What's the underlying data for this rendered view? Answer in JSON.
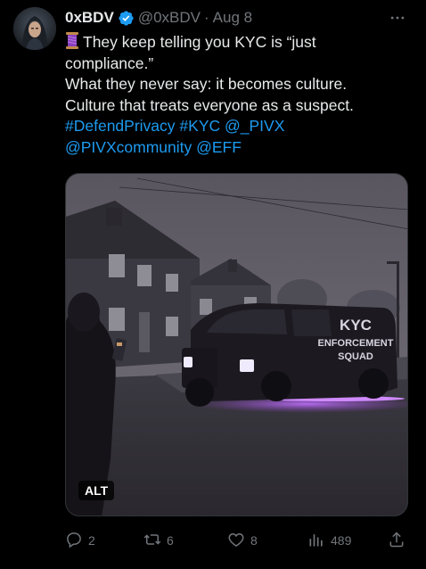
{
  "author": {
    "display_name": "0xBDV",
    "handle": "@0xBDV",
    "separator": "·",
    "date": "Aug 8",
    "verified": true
  },
  "tweet": {
    "line1_rest": "They keep telling you KYC is “just",
    "line2": "compliance.”",
    "line3": "What they never say: it becomes culture.",
    "line4": "Culture that treats everyone as a suspect.",
    "hashtags": [
      "#DefendPrivacy",
      "#KYC"
    ],
    "mentions": [
      "@_PIVX",
      "@PIVXcommunity",
      "@EFF"
    ]
  },
  "media": {
    "alt_badge": "ALT",
    "van_text": [
      "KYC",
      "ENFORCEMENT",
      "SQUAD"
    ]
  },
  "actions": {
    "replies": "2",
    "reposts": "6",
    "likes": "8",
    "views": "489"
  },
  "icons": {
    "more": "more-icon",
    "reply": "reply-icon",
    "repost": "repost-icon",
    "like": "heart-icon",
    "views": "views-icon",
    "share": "share-icon",
    "verified": "verified-badge-icon",
    "thread": "thread-emoji-icon"
  },
  "colors": {
    "background": "#000000",
    "text": "#e7e9ea",
    "muted": "#71767b",
    "link": "#1d9bf0",
    "verified": "#1d9bf0"
  }
}
